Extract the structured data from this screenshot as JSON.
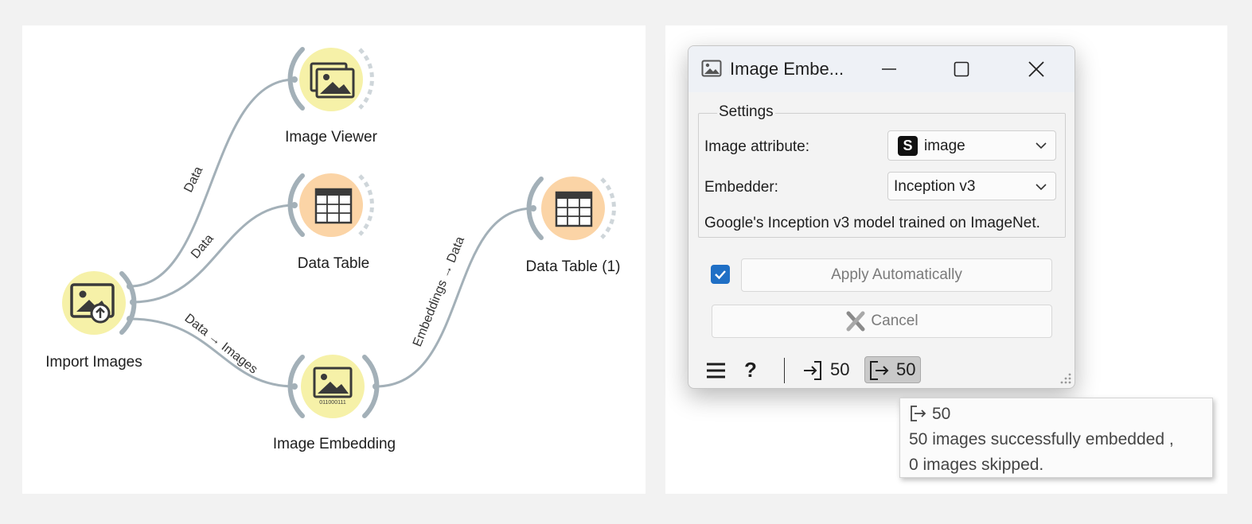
{
  "canvas": {
    "nodes": {
      "import_images": {
        "label": "Import Images"
      },
      "image_viewer": {
        "label": "Image Viewer"
      },
      "data_table": {
        "label": "Data Table"
      },
      "image_embedding": {
        "label": "Image Embedding",
        "icon_caption": "011000111"
      },
      "data_table_1": {
        "label": "Data Table (1)"
      }
    },
    "links": {
      "to_viewer": "Data",
      "to_table": "Data",
      "to_embedding": "Data → Images",
      "embedding_to_table": "Embeddings → Data"
    }
  },
  "dialog": {
    "title": "Image Embe...",
    "settings_title": "Settings",
    "image_attribute_label": "Image attribute:",
    "image_attribute_badge": "S",
    "image_attribute_value": "image",
    "embedder_label": "Embedder:",
    "embedder_value": "Inception v3",
    "description": "Google's Inception v3 model trained on ImageNet.",
    "apply_checked": true,
    "apply_label": "Apply Automatically",
    "cancel_label": "Cancel",
    "status": {
      "input_count": "50",
      "output_count": "50"
    }
  },
  "tooltip": {
    "count": "50",
    "line1": "50 images successfully embedded ,",
    "line2": "0 images skipped."
  },
  "colors": {
    "yellow_node": "#f6f1a8",
    "orange_node": "#fbd4a6",
    "link": "#a3b0b8",
    "accent": "#1f6fc5"
  }
}
